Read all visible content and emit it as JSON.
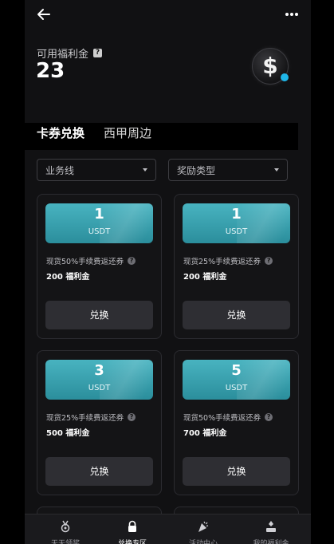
{
  "header": {
    "back_icon": "arrow-left-icon",
    "more_icon": "more-dots-icon"
  },
  "balance": {
    "label": "可用福利金",
    "value": "23",
    "coin_symbol": "$"
  },
  "tabs": [
    {
      "label": "卡券兑换",
      "active": true
    },
    {
      "label": "西甲周边",
      "active": false
    }
  ],
  "filters": [
    {
      "label": "业务线"
    },
    {
      "label": "奖励类型"
    }
  ],
  "cards": [
    {
      "amount": "1",
      "unit": "USDT",
      "desc": "现货50%手续费返还券",
      "cost": "200 福利金",
      "button": "兑换"
    },
    {
      "amount": "1",
      "unit": "USDT",
      "desc": "现货25%手续费返还券",
      "cost": "200 福利金",
      "button": "兑换"
    },
    {
      "amount": "3",
      "unit": "USDT",
      "desc": "现货25%手续费返还券",
      "cost": "500 福利金",
      "button": "兑换"
    },
    {
      "amount": "5",
      "unit": "USDT",
      "desc": "现货50%手续费返还券",
      "cost": "700 福利金",
      "button": "兑换"
    }
  ],
  "bottom_nav": [
    {
      "label": "天天领奖",
      "icon": "medal-icon",
      "active": false
    },
    {
      "label": "兑换专区",
      "icon": "lock-icon",
      "active": true
    },
    {
      "label": "活动中心",
      "icon": "party-popper-icon",
      "active": false
    },
    {
      "label": "我的福利金",
      "icon": "user-reward-icon",
      "active": false
    }
  ],
  "colors": {
    "background": "#111113",
    "ticket": "#3aa3b1",
    "accent_dot": "#1fb6e8"
  }
}
